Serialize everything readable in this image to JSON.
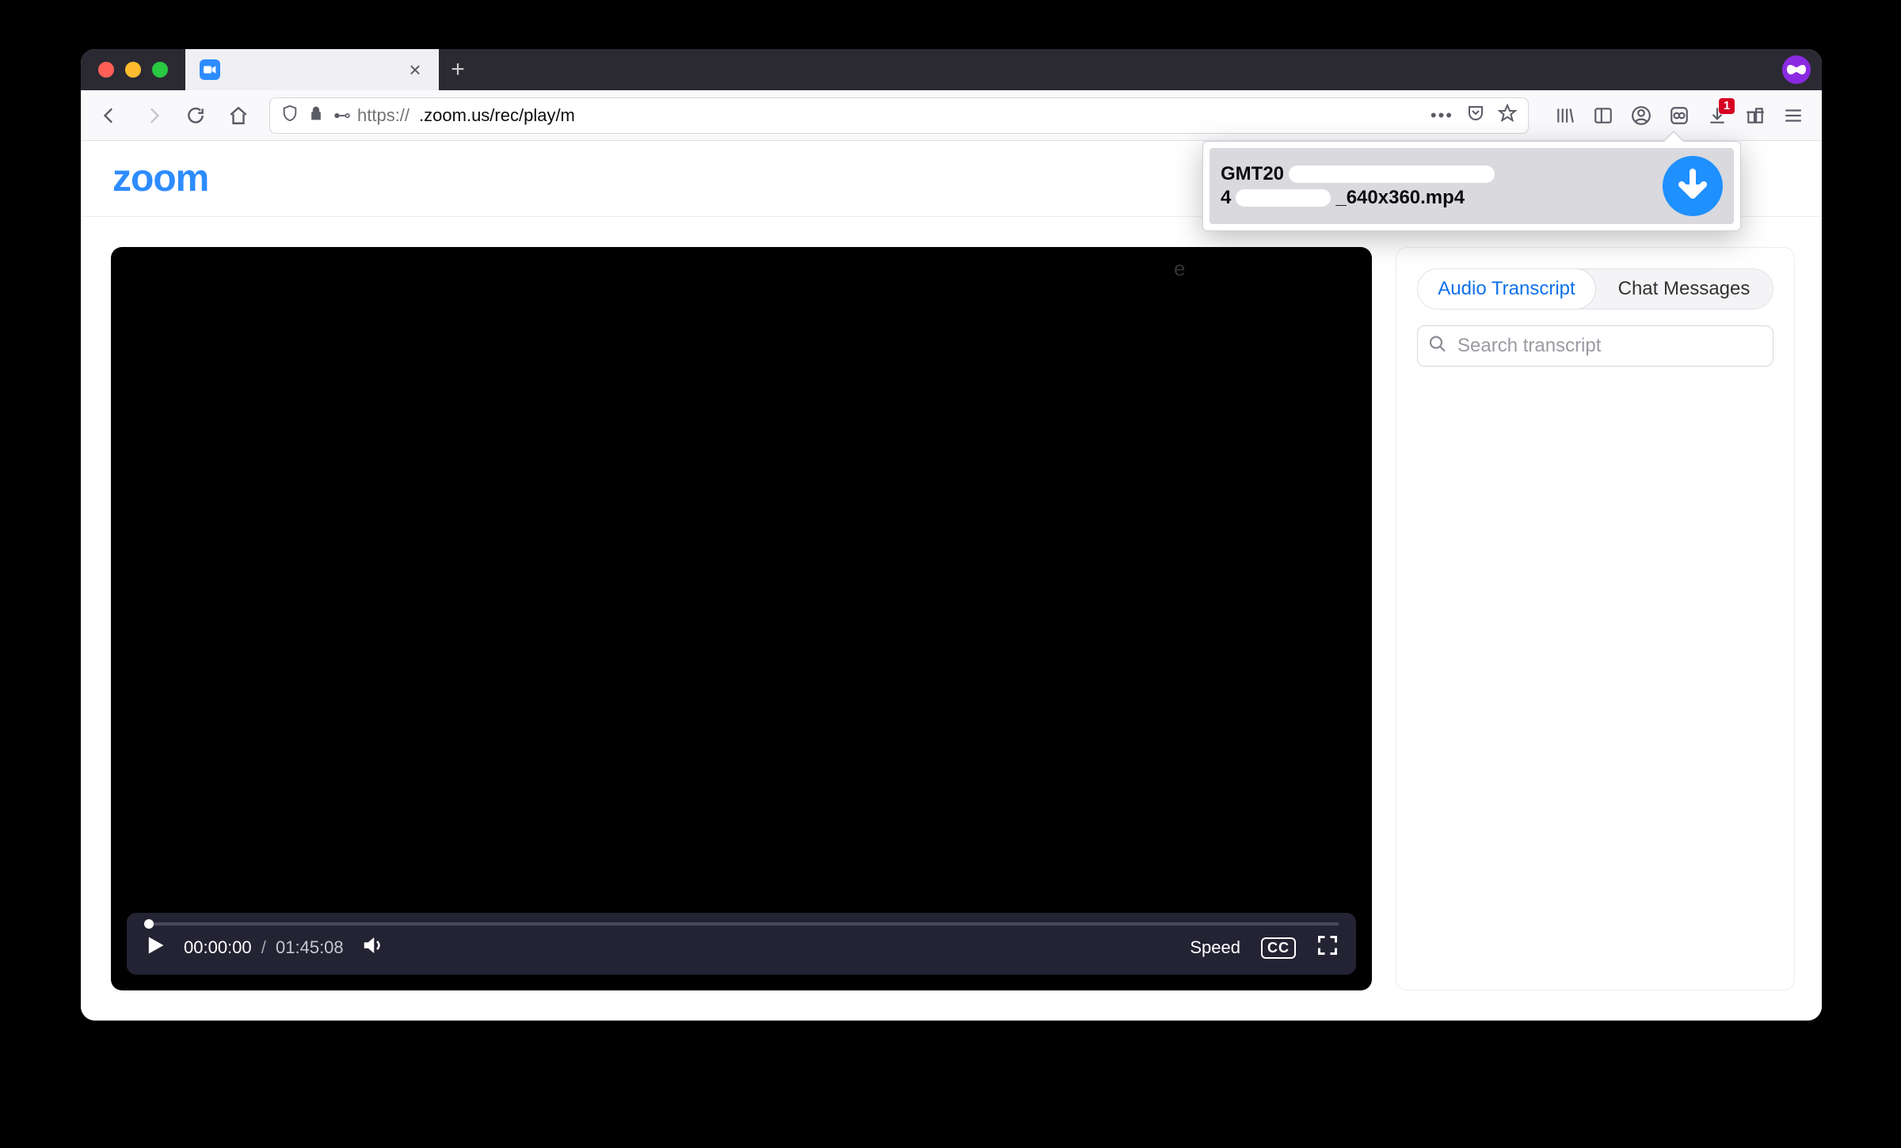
{
  "browser": {
    "tab_title": "",
    "url_protocol": "https://",
    "url_display": ".zoom.us/rec/play/m",
    "download_badge": "1"
  },
  "download_popup": {
    "line1_prefix": "GMT20",
    "line2_prefix": "4",
    "line2_suffix": "_640x360.mp4"
  },
  "zoom": {
    "logo_text": "zoom",
    "stray_char": "e"
  },
  "player": {
    "current_time": "00:00:00",
    "separator": "/",
    "total_time": "01:45:08",
    "speed_label": "Speed",
    "cc_label": "CC"
  },
  "sidebar": {
    "tabs": {
      "transcript": "Audio Transcript",
      "chat": "Chat Messages"
    },
    "search_placeholder": "Search transcript"
  }
}
